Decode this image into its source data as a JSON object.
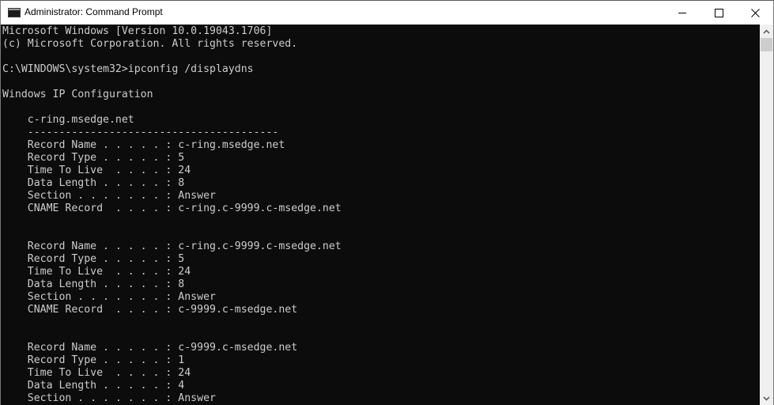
{
  "window": {
    "title": "Administrator: Command Prompt",
    "app_icon": "cmd-icon",
    "controls": {
      "minimize": "minimize-icon",
      "maximize": "maximize-icon",
      "close": "close-icon"
    }
  },
  "console": {
    "background": "#0c0c0c",
    "foreground": "#cccccc",
    "lines": [
      "Microsoft Windows [Version 10.0.19043.1706]",
      "(c) Microsoft Corporation. All rights reserved.",
      "",
      "C:\\WINDOWS\\system32>ipconfig /displaydns",
      "",
      "Windows IP Configuration",
      "",
      "    c-ring.msedge.net",
      "    ----------------------------------------",
      "    Record Name . . . . . : c-ring.msedge.net",
      "    Record Type . . . . . : 5",
      "    Time To Live  . . . . : 24",
      "    Data Length . . . . . : 8",
      "    Section . . . . . . . : Answer",
      "    CNAME Record  . . . . : c-ring.c-9999.c-msedge.net",
      "",
      "",
      "    Record Name . . . . . : c-ring.c-9999.c-msedge.net",
      "    Record Type . . . . . : 5",
      "    Time To Live  . . . . : 24",
      "    Data Length . . . . . : 8",
      "    Section . . . . . . . : Answer",
      "    CNAME Record  . . . . : c-9999.c-msedge.net",
      "",
      "",
      "    Record Name . . . . . : c-9999.c-msedge.net",
      "    Record Type . . . . . : 1",
      "    Time To Live  . . . . : 24",
      "    Data Length . . . . . : 4",
      "    Section . . . . . . . : Answer"
    ]
  },
  "scrollbar": {
    "up_icon": "chevron-up-icon",
    "down_icon": "chevron-down-icon"
  }
}
